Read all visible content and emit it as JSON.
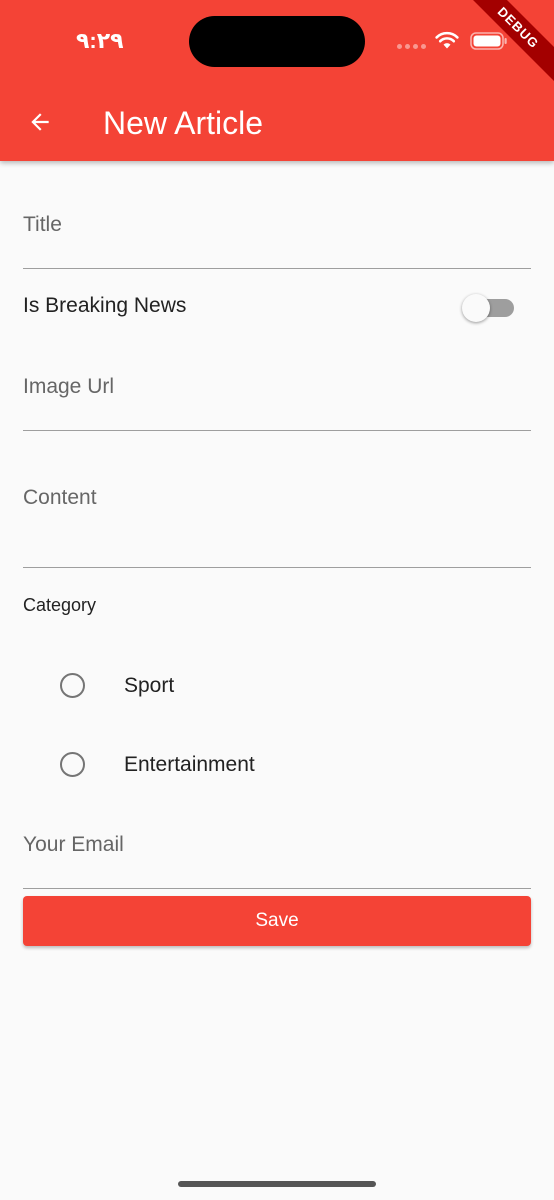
{
  "status_bar": {
    "time": "٩:٢٩"
  },
  "debug_banner": "DEBUG",
  "appbar": {
    "title": "New Article"
  },
  "form": {
    "title_label": "Title",
    "breaking_label": "Is Breaking News",
    "breaking_on": false,
    "image_url_label": "Image Url",
    "content_label": "Content",
    "category_label": "Category",
    "categories": [
      {
        "label": "Sport",
        "selected": false
      },
      {
        "label": "Entertainment",
        "selected": false
      }
    ],
    "email_label": "Your Email",
    "save_label": "Save"
  },
  "colors": {
    "primary": "#F44336",
    "background": "#FAFAFA"
  },
  "icons": {
    "back": "arrow-back-icon",
    "wifi": "wifi-icon",
    "battery": "battery-icon"
  }
}
